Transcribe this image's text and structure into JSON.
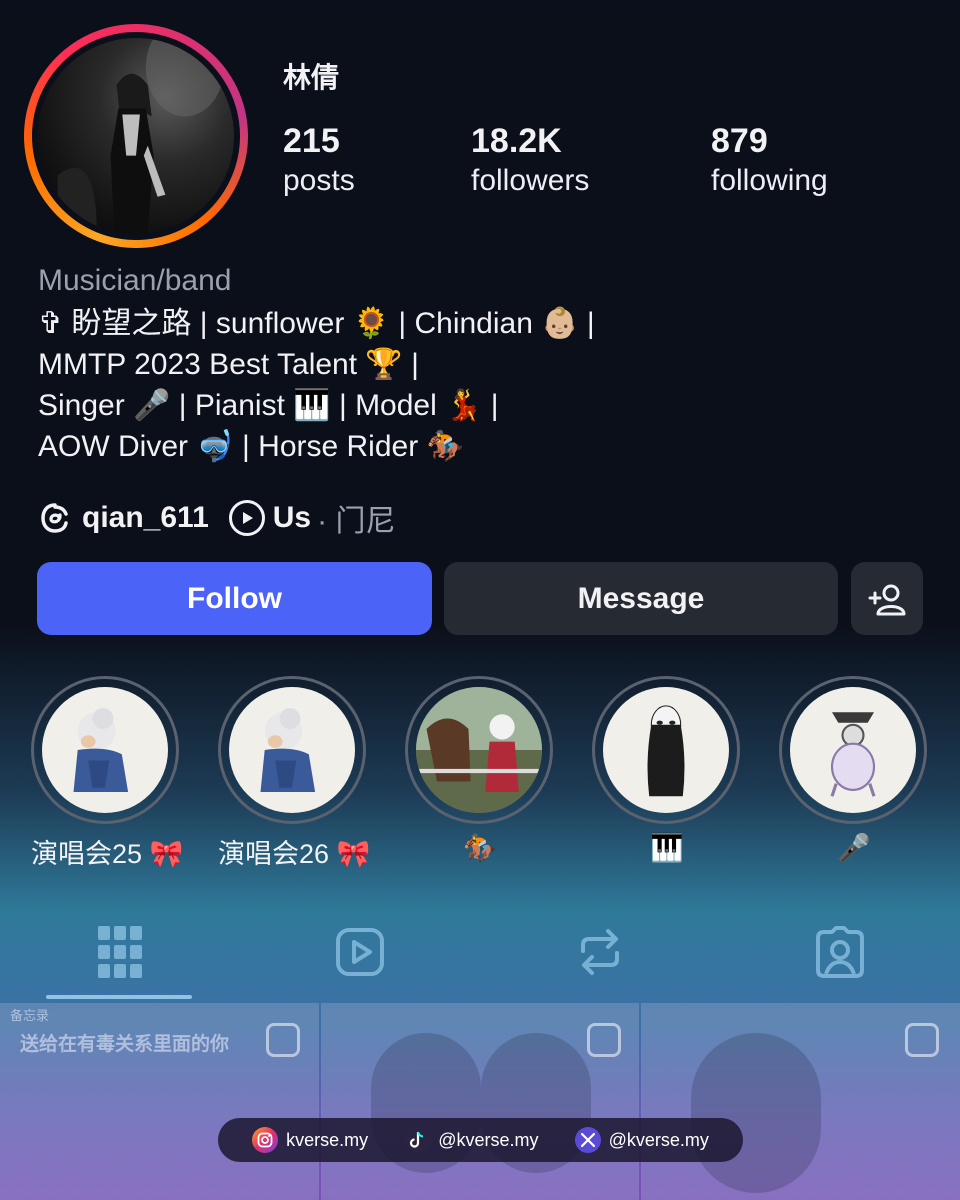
{
  "profile": {
    "username": "林倩",
    "stats": [
      {
        "value": "215",
        "label": "posts"
      },
      {
        "value": "18.2K",
        "label": "followers"
      },
      {
        "value": "879",
        "label": "following"
      }
    ],
    "category": "Musician/band",
    "bio_lines": [
      "✞ 盼望之路 | sunflower 🌻 | Chindian 👶🏼 |",
      "MMTP 2023 Best Talent 🏆 |",
      "Singer 🎤 | Pianist 🎹 | Model 💃 |",
      "AOW Diver 🤿 | Horse Rider 🏇"
    ],
    "threads_handle": "qian_611",
    "music_title": "Us",
    "music_artist": "· 门尼"
  },
  "buttons": {
    "follow": "Follow",
    "message": "Message",
    "add_user_icon": "add-person-icon"
  },
  "highlights": [
    {
      "label": "演唱会25 🎀"
    },
    {
      "label": "演唱会26 🎀"
    },
    {
      "label": "🏇"
    },
    {
      "label": "🎹"
    },
    {
      "label": "🎤"
    }
  ],
  "tabs": [
    "grid-icon",
    "reels-icon",
    "reposts-icon",
    "tagged-icon"
  ],
  "grid_preview": {
    "note_back": "备忘录",
    "note_title": "送给在有毒关系里面的你"
  },
  "social": [
    {
      "icon": "instagram-icon",
      "handle": "kverse.my"
    },
    {
      "icon": "tiktok-icon",
      "handle": "@kverse.my"
    },
    {
      "icon": "x-icon",
      "handle": "@kverse.my"
    }
  ],
  "colors": {
    "follow_button": "#4b63f7",
    "secondary_button": "#262a33",
    "muted_text": "#9aa0ad"
  }
}
